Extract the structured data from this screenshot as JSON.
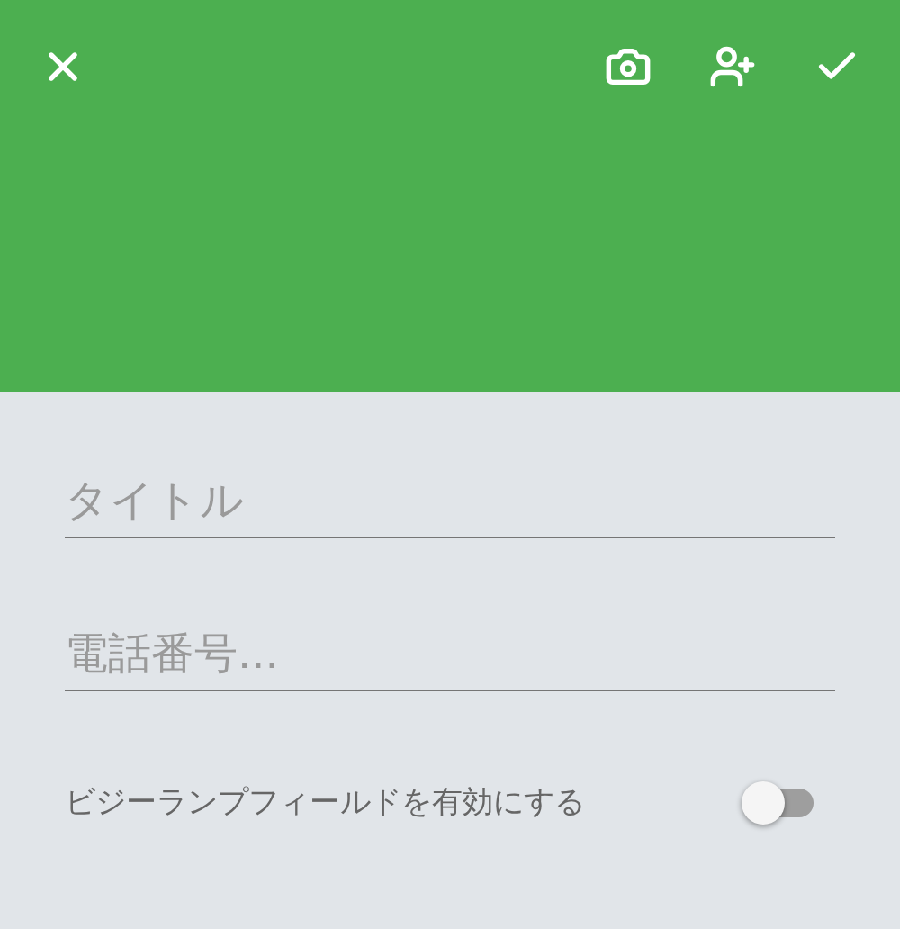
{
  "fields": [
    {
      "placeholder": "タイトル"
    },
    {
      "placeholder": "電話番号..."
    }
  ],
  "toggle": {
    "label": "ビジーランプフィールドを有効にする",
    "on": false
  }
}
